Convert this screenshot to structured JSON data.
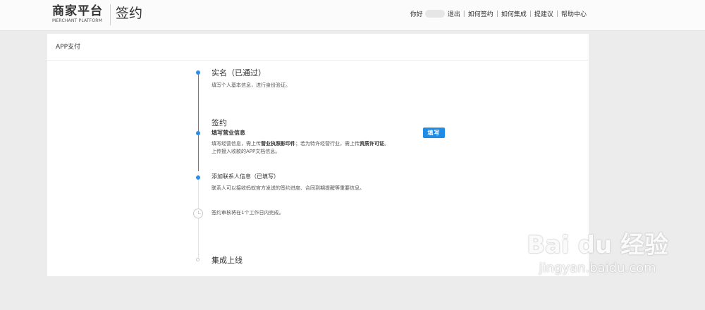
{
  "header": {
    "logo_title": "商家平台",
    "logo_subtitle": "MERCHANT PLATFORM",
    "page_name": "签约",
    "greeting": "你好",
    "nav": [
      "退出",
      "如何签约",
      "如何集成",
      "提建议",
      "帮助中心"
    ]
  },
  "panel": {
    "title": "APP支付"
  },
  "steps": {
    "realname": {
      "title": "实名（已通过）",
      "desc": "填写个人基本信息，进行身份验证。"
    },
    "contract": {
      "title": "签约",
      "sub_title": "填写营业信息",
      "desc1_a": "填写经营信息，需上传",
      "desc1_b": "营业执照影印件",
      "desc1_c": "；若为特许经营行业，需上传",
      "desc1_d": "资质许可证",
      "desc1_e": "。",
      "desc2": "上传接入收款的APP文档信息。",
      "button": "填写"
    },
    "contact": {
      "title": "添加联系人信息（已填写）",
      "desc": "联系人可以接收蚂蚁官方发送的签约进度、合同到期提醒等重要信息。"
    },
    "review": {
      "desc": "签约审核将在1个工作日内完成。"
    },
    "launch": {
      "title": "集成上线"
    }
  },
  "watermark": {
    "main": "Bai du 经验",
    "sub": "jingyan.baidu.com"
  },
  "colors": {
    "accent": "#1f8ce6",
    "timeline_done": "#2b8ee8",
    "timeline_todo": "#e4e4e4",
    "background": "#ececec"
  },
  "icons": [
    "timeline-dot-icon",
    "clock-icon",
    "avatar"
  ]
}
